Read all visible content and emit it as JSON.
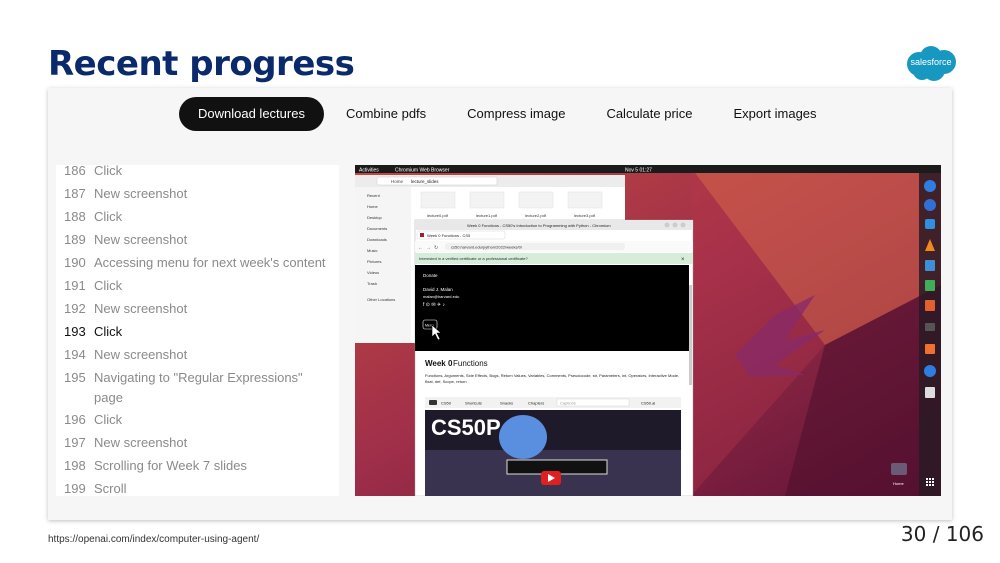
{
  "slide": {
    "title": "Recent progress",
    "logo_text": "salesforce",
    "footer_url": "https://openai.com/index/computer-using-agent/",
    "page_number": "30 / 106"
  },
  "tabs": [
    {
      "label": "Download lectures",
      "active": true
    },
    {
      "label": "Combine pdfs",
      "active": false
    },
    {
      "label": "Compress image",
      "active": false
    },
    {
      "label": "Calculate price",
      "active": false
    },
    {
      "label": "Export images",
      "active": false
    }
  ],
  "steps": [
    {
      "num": "186",
      "text": "Click"
    },
    {
      "num": "187",
      "text": "New screenshot"
    },
    {
      "num": "188",
      "text": "Click"
    },
    {
      "num": "189",
      "text": "New screenshot"
    },
    {
      "num": "190",
      "text": "Accessing menu for next week's content"
    },
    {
      "num": "191",
      "text": "Click"
    },
    {
      "num": "192",
      "text": "New screenshot"
    },
    {
      "num": "193",
      "text": "Click",
      "current": true
    },
    {
      "num": "194",
      "text": "New screenshot"
    },
    {
      "num": "195",
      "text": "Navigating to \"Regular Expressions\" page"
    },
    {
      "num": "196",
      "text": "Click"
    },
    {
      "num": "197",
      "text": "New screenshot"
    },
    {
      "num": "198",
      "text": "Scrolling for Week 7 slides"
    },
    {
      "num": "199",
      "text": "Scroll"
    }
  ],
  "desktop": {
    "topbar_left": "Activities",
    "topbar_app": "Chromium Web Browser",
    "topbar_clock": "Nov 5  01:27",
    "files": {
      "breadcrumb_home": "Home",
      "breadcrumb_folder": "lecture_slides",
      "sidebar": [
        "Recent",
        "Home",
        "Desktop",
        "Documents",
        "Downloads",
        "Music",
        "Pictures",
        "Videos",
        "Trash",
        "Other Locations"
      ],
      "file_names": [
        "lecture0.pdf",
        "lecture1.pdf",
        "lecture2.pdf",
        "lecture3.pdf"
      ]
    },
    "browser": {
      "window_title": "Week 0 Functions - CS50's Introduction to Programming with Python - Chromium",
      "tab_title": "Week 0 Functions - CS5",
      "url": "cs50.harvard.edu/python/2022/weeks/0/",
      "banner": "Interested in a verified certificate or a professional certificate?",
      "donate": "Donate",
      "author_name": "David J. Malan",
      "author_email": "malan@harvard.edu",
      "menu_button": "Menu",
      "heading_week": "Week 0",
      "heading_topic": "Functions",
      "topics": "Functions, Arguments, Side Effects, Bugs, Return Values, Variables, Comments, Pseudocode, str, Parameters, int, Operators, Interactive Mode, float, def, Scope, return",
      "video_bar_label": "CS50",
      "video_bar_shortcuts": "Shortcuts",
      "video_bar_snacks": "Snacks",
      "video_bar_chapters": "Chapters",
      "video_bar_captions": "Captions",
      "video_bar_ai": "CS50.ai",
      "video_title": "CS50P"
    },
    "dock_trash_label": "Home"
  }
}
